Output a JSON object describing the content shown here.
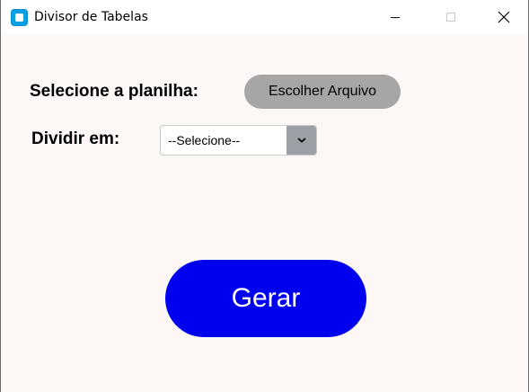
{
  "window": {
    "title": "Divisor de Tabelas",
    "icon": "app-window-icon",
    "controls": [
      "minimize-icon",
      "maximize-icon",
      "close-icon"
    ]
  },
  "form": {
    "spreadsheet_label": "Selecione a planilha:",
    "file_button_label": "Escolher Arquivo",
    "split_label": "Dividir em:",
    "split_select": {
      "selected": "--Selecione--"
    },
    "generate_button_label": "Gerar"
  },
  "colors": {
    "accent": "#0000ee",
    "file_button_bg": "#a6a6a6",
    "window_bg": "#fdf7f6"
  }
}
